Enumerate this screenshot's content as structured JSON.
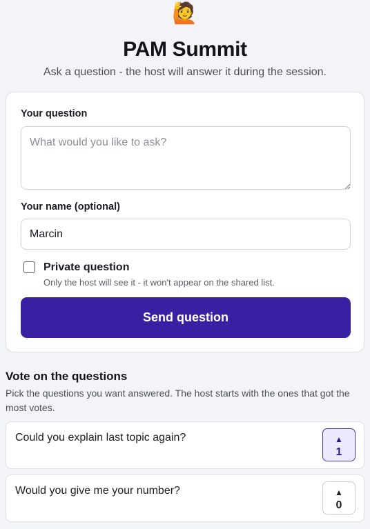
{
  "header": {
    "emoji": "🙋",
    "title": "PAM Summit",
    "subtitle": "Ask a question - the host will answer it during the session."
  },
  "form": {
    "question_label": "Your question",
    "question_placeholder": "What would you like to ask?",
    "question_value": "",
    "name_label": "Your name (optional)",
    "name_value": "Marcin",
    "private_label": "Private question",
    "private_checked": false,
    "private_hint": "Only the host will see it - it won't appear on the shared list.",
    "send_label": "Send question"
  },
  "voting": {
    "title": "Vote on the questions",
    "description": "Pick the questions you want answered. The host starts with the ones that got the most votes.",
    "arrow": "▲",
    "questions": [
      {
        "text": "Could you explain last topic again?",
        "votes": "1",
        "voted": true
      },
      {
        "text": "Would you give me your number?",
        "votes": "0",
        "voted": false
      }
    ]
  },
  "colors": {
    "accent": "#3b1fa3",
    "voted_bg": "#ece9fc",
    "page_bg": "#f3f4f7"
  }
}
